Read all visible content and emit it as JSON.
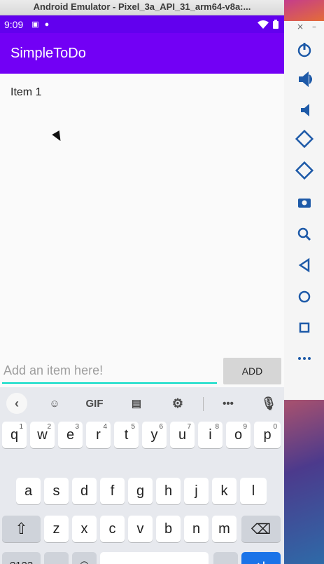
{
  "window": {
    "title": "Android Emulator - Pixel_3a_API_31_arm64-v8a:..."
  },
  "status_bar": {
    "time": "9:09",
    "left_icons": [
      "a-icon",
      "chat-icon"
    ],
    "right_icons": [
      "wifi-icon",
      "battery-icon"
    ]
  },
  "app_bar": {
    "title": "SimpleToDo"
  },
  "list": {
    "items": [
      "Item 1"
    ]
  },
  "input": {
    "placeholder": "Add an item here!",
    "value": ""
  },
  "add_button": {
    "label": "ADD"
  },
  "keyboard": {
    "suggestion_strip": [
      "back-icon",
      "sticker-icon",
      "GIF",
      "clipboard-icon",
      "settings-icon",
      "more-icon",
      "mic-icon"
    ],
    "row1": [
      {
        "key": "q",
        "num": "1"
      },
      {
        "key": "w",
        "num": "2"
      },
      {
        "key": "e",
        "num": "3"
      },
      {
        "key": "r",
        "num": "4"
      },
      {
        "key": "t",
        "num": "5"
      },
      {
        "key": "y",
        "num": "6"
      },
      {
        "key": "u",
        "num": "7"
      },
      {
        "key": "i",
        "num": "8"
      },
      {
        "key": "o",
        "num": "9"
      },
      {
        "key": "p",
        "num": "0"
      }
    ],
    "row2": [
      "a",
      "s",
      "d",
      "f",
      "g",
      "h",
      "j",
      "k",
      "l"
    ],
    "row3": [
      "z",
      "x",
      "c",
      "v",
      "b",
      "n",
      "m"
    ],
    "row4": {
      "symbols": "?123",
      "comma": ",",
      "period": "."
    }
  }
}
